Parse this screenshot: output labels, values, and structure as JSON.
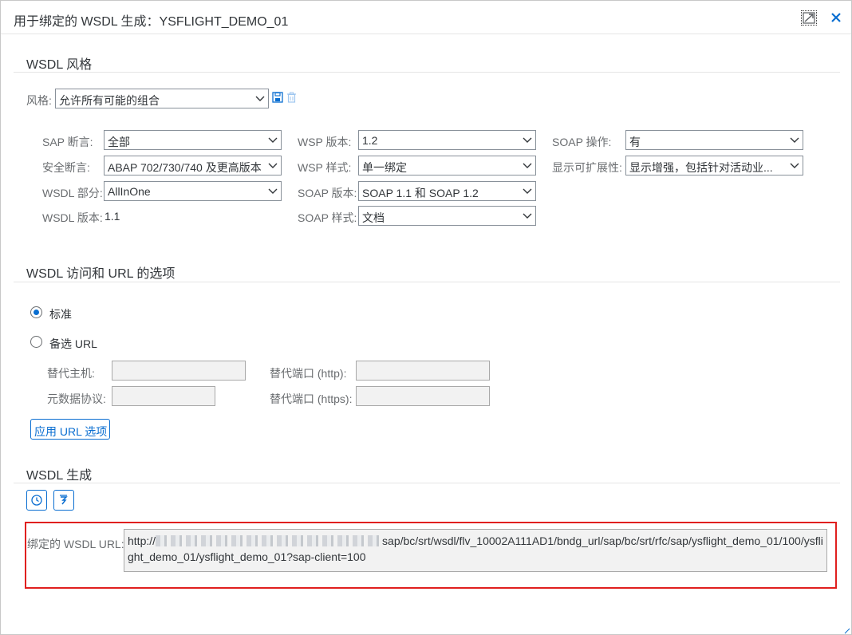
{
  "dialog": {
    "title": "用于绑定的 WSDL 生成：YSFLIGHT_DEMO_01"
  },
  "style_section": {
    "title": "WSDL 风格",
    "style_label": "风格:",
    "style_value": "允许所有可能的组合",
    "fields": {
      "sap_assert": {
        "label": "SAP 断言:",
        "value": "全部"
      },
      "security_assert": {
        "label": "安全断言:",
        "value": "ABAP 702/730/740 及更高版本"
      },
      "wsdl_part": {
        "label": "WSDL 部分:",
        "value": "AllInOne"
      },
      "wsdl_version": {
        "label": "WSDL 版本:",
        "value": "1.1"
      },
      "wsp_version": {
        "label": "WSP 版本:",
        "value": "1.2"
      },
      "wsp_style": {
        "label": "WSP 样式:",
        "value": "单一绑定"
      },
      "soap_version": {
        "label": "SOAP 版本:",
        "value": "SOAP 1.1 和 SOAP 1.2"
      },
      "soap_style": {
        "label": "SOAP 样式:",
        "value": "文档"
      },
      "soap_operation": {
        "label": "SOAP 操作:",
        "value": "有"
      },
      "extensibility": {
        "label": "显示可扩展性:",
        "value": "显示增强，包括针对活动业..."
      }
    }
  },
  "url_section": {
    "title": "WSDL 访问和 URL 的选项",
    "radio_standard": "标准",
    "radio_alt": "备选 URL",
    "alt_host_label": "替代主机:",
    "alt_port_http_label": "替代端口 (http):",
    "metadata_protocol_label": "元数据协议:",
    "alt_port_https_label": "替代端口 (https):",
    "apply_button": "应用 URL 选项",
    "selected": "standard"
  },
  "gen_section": {
    "title": "WSDL 生成",
    "bound_url_label": "绑定的 WSDL URL:",
    "url_prefix": "http://",
    "url_suffix": "sap/bc/srt/wsdl/flv_10002A111AD1/bndg_url/sap/bc/srt/rfc/sap/ysflight_demo_01/100/ysflight_demo_01/ysflight_demo_01?sap-client=100"
  },
  "icons": [
    "resize-icon",
    "close-icon",
    "save-icon",
    "delete-icon",
    "chevron-down-icon",
    "clock-icon",
    "run-icon"
  ],
  "colors": {
    "accent": "#0a6ed1",
    "highlight_border": "#e0201f",
    "label": "#6a6d70"
  }
}
